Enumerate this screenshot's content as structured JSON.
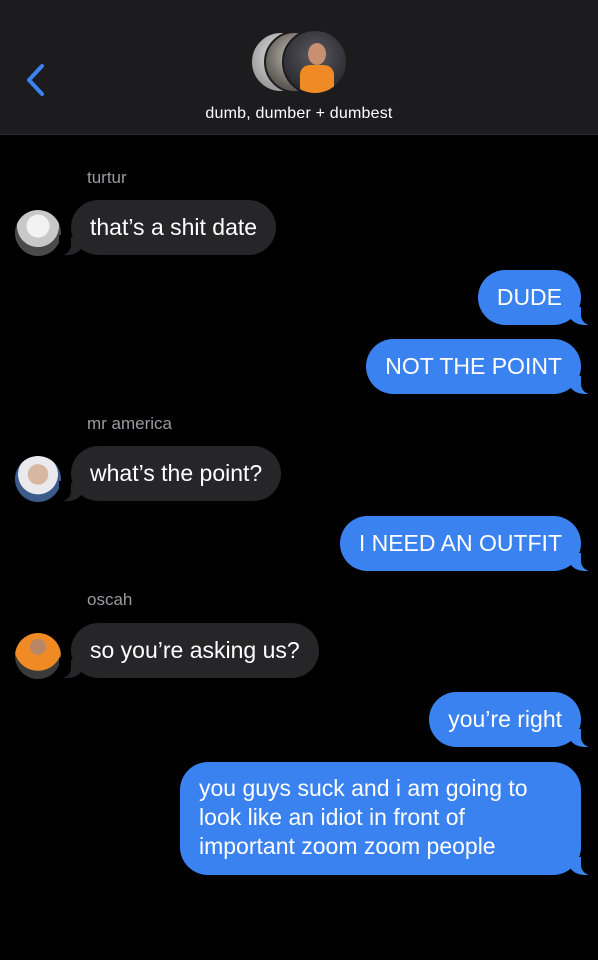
{
  "header": {
    "group_name": "dumb, dumber + dumbest",
    "back_icon": "chevron-left-icon",
    "accent": "#3b82f1"
  },
  "messages": [
    {
      "sender": "turtur",
      "text": "that’s a shit date"
    },
    {
      "text": "DUDE"
    },
    {
      "text": "NOT THE POINT"
    },
    {
      "sender": "mr america",
      "text": "what’s the point?"
    },
    {
      "text": "I NEED AN OUTFIT"
    },
    {
      "sender": "oscah",
      "text": "so you’re asking us?"
    },
    {
      "text": "you’re right"
    },
    {
      "text": "you guys suck and i am going to look like an idiot in front of important zoom zoom people"
    }
  ],
  "colors": {
    "incoming_bubble": "#262628",
    "outgoing_bubble": "#3b82f1",
    "header_bg": "#1c1c1e"
  }
}
